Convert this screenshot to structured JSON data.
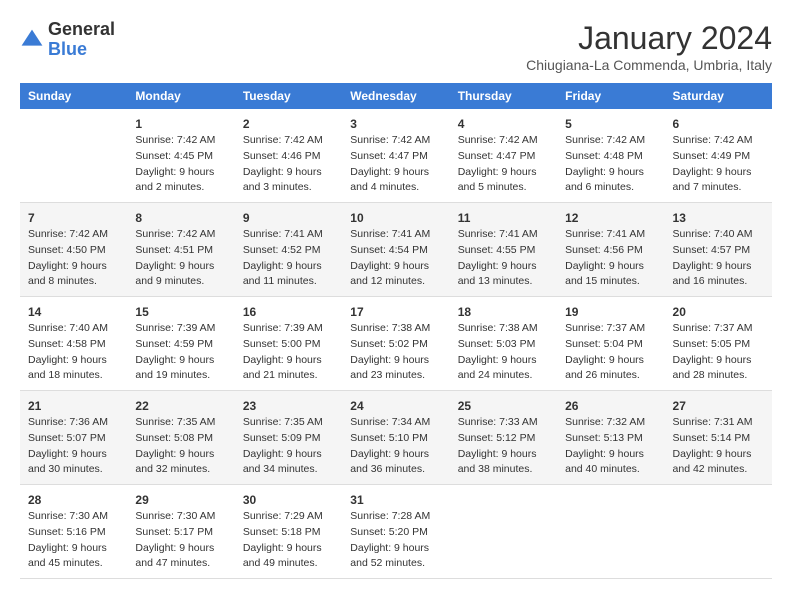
{
  "logo": {
    "general": "General",
    "blue": "Blue"
  },
  "title": "January 2024",
  "location": "Chiugiana-La Commenda, Umbria, Italy",
  "weekdays": [
    "Sunday",
    "Monday",
    "Tuesday",
    "Wednesday",
    "Thursday",
    "Friday",
    "Saturday"
  ],
  "weeks": [
    [
      {
        "day": "",
        "info": ""
      },
      {
        "day": "1",
        "info": "Sunrise: 7:42 AM\nSunset: 4:45 PM\nDaylight: 9 hours\nand 2 minutes."
      },
      {
        "day": "2",
        "info": "Sunrise: 7:42 AM\nSunset: 4:46 PM\nDaylight: 9 hours\nand 3 minutes."
      },
      {
        "day": "3",
        "info": "Sunrise: 7:42 AM\nSunset: 4:47 PM\nDaylight: 9 hours\nand 4 minutes."
      },
      {
        "day": "4",
        "info": "Sunrise: 7:42 AM\nSunset: 4:47 PM\nDaylight: 9 hours\nand 5 minutes."
      },
      {
        "day": "5",
        "info": "Sunrise: 7:42 AM\nSunset: 4:48 PM\nDaylight: 9 hours\nand 6 minutes."
      },
      {
        "day": "6",
        "info": "Sunrise: 7:42 AM\nSunset: 4:49 PM\nDaylight: 9 hours\nand 7 minutes."
      }
    ],
    [
      {
        "day": "7",
        "info": "Sunrise: 7:42 AM\nSunset: 4:50 PM\nDaylight: 9 hours\nand 8 minutes."
      },
      {
        "day": "8",
        "info": "Sunrise: 7:42 AM\nSunset: 4:51 PM\nDaylight: 9 hours\nand 9 minutes."
      },
      {
        "day": "9",
        "info": "Sunrise: 7:41 AM\nSunset: 4:52 PM\nDaylight: 9 hours\nand 11 minutes."
      },
      {
        "day": "10",
        "info": "Sunrise: 7:41 AM\nSunset: 4:54 PM\nDaylight: 9 hours\nand 12 minutes."
      },
      {
        "day": "11",
        "info": "Sunrise: 7:41 AM\nSunset: 4:55 PM\nDaylight: 9 hours\nand 13 minutes."
      },
      {
        "day": "12",
        "info": "Sunrise: 7:41 AM\nSunset: 4:56 PM\nDaylight: 9 hours\nand 15 minutes."
      },
      {
        "day": "13",
        "info": "Sunrise: 7:40 AM\nSunset: 4:57 PM\nDaylight: 9 hours\nand 16 minutes."
      }
    ],
    [
      {
        "day": "14",
        "info": "Sunrise: 7:40 AM\nSunset: 4:58 PM\nDaylight: 9 hours\nand 18 minutes."
      },
      {
        "day": "15",
        "info": "Sunrise: 7:39 AM\nSunset: 4:59 PM\nDaylight: 9 hours\nand 19 minutes."
      },
      {
        "day": "16",
        "info": "Sunrise: 7:39 AM\nSunset: 5:00 PM\nDaylight: 9 hours\nand 21 minutes."
      },
      {
        "day": "17",
        "info": "Sunrise: 7:38 AM\nSunset: 5:02 PM\nDaylight: 9 hours\nand 23 minutes."
      },
      {
        "day": "18",
        "info": "Sunrise: 7:38 AM\nSunset: 5:03 PM\nDaylight: 9 hours\nand 24 minutes."
      },
      {
        "day": "19",
        "info": "Sunrise: 7:37 AM\nSunset: 5:04 PM\nDaylight: 9 hours\nand 26 minutes."
      },
      {
        "day": "20",
        "info": "Sunrise: 7:37 AM\nSunset: 5:05 PM\nDaylight: 9 hours\nand 28 minutes."
      }
    ],
    [
      {
        "day": "21",
        "info": "Sunrise: 7:36 AM\nSunset: 5:07 PM\nDaylight: 9 hours\nand 30 minutes."
      },
      {
        "day": "22",
        "info": "Sunrise: 7:35 AM\nSunset: 5:08 PM\nDaylight: 9 hours\nand 32 minutes."
      },
      {
        "day": "23",
        "info": "Sunrise: 7:35 AM\nSunset: 5:09 PM\nDaylight: 9 hours\nand 34 minutes."
      },
      {
        "day": "24",
        "info": "Sunrise: 7:34 AM\nSunset: 5:10 PM\nDaylight: 9 hours\nand 36 minutes."
      },
      {
        "day": "25",
        "info": "Sunrise: 7:33 AM\nSunset: 5:12 PM\nDaylight: 9 hours\nand 38 minutes."
      },
      {
        "day": "26",
        "info": "Sunrise: 7:32 AM\nSunset: 5:13 PM\nDaylight: 9 hours\nand 40 minutes."
      },
      {
        "day": "27",
        "info": "Sunrise: 7:31 AM\nSunset: 5:14 PM\nDaylight: 9 hours\nand 42 minutes."
      }
    ],
    [
      {
        "day": "28",
        "info": "Sunrise: 7:30 AM\nSunset: 5:16 PM\nDaylight: 9 hours\nand 45 minutes."
      },
      {
        "day": "29",
        "info": "Sunrise: 7:30 AM\nSunset: 5:17 PM\nDaylight: 9 hours\nand 47 minutes."
      },
      {
        "day": "30",
        "info": "Sunrise: 7:29 AM\nSunset: 5:18 PM\nDaylight: 9 hours\nand 49 minutes."
      },
      {
        "day": "31",
        "info": "Sunrise: 7:28 AM\nSunset: 5:20 PM\nDaylight: 9 hours\nand 52 minutes."
      },
      {
        "day": "",
        "info": ""
      },
      {
        "day": "",
        "info": ""
      },
      {
        "day": "",
        "info": ""
      }
    ]
  ]
}
